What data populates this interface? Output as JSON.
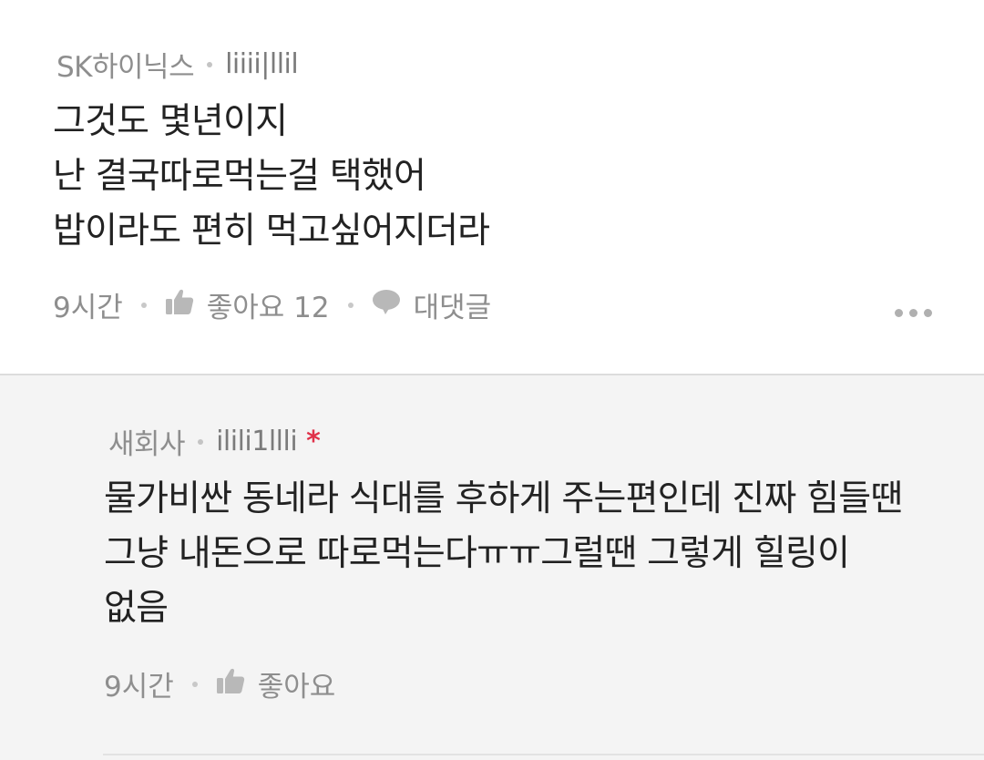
{
  "comments": [
    {
      "author": "SK하이닉스",
      "user_id": "liiii|llil",
      "body_lines": [
        "그것도 몇년이지",
        "난 결국따로먹는걸 택했어",
        "밥이라도 편히 먹고싶어지더라"
      ],
      "time": "9시간",
      "like_label": "좋아요 12",
      "reply_label": "대댓글"
    },
    {
      "author": "새회사",
      "user_id": "ilili1llli",
      "marker": "*",
      "body_lines": [
        "물가비싼 동네라 식대를 후하게 주는편인데 진짜 힘들땐",
        "그냥 내돈으로 따로먹는다ㅠㅠ그럴땐 그렇게 힐링이",
        "없음"
      ],
      "time": "9시간",
      "like_label": "좋아요"
    }
  ],
  "icons": {
    "like": "thumbs-up-icon",
    "reply": "speech-bubble-icon",
    "more": "more-dots-icon"
  },
  "colors": {
    "text_primary": "#222222",
    "text_meta": "#8e8e8e",
    "reply_background": "#f4f4f4",
    "star": "#e0324a"
  }
}
